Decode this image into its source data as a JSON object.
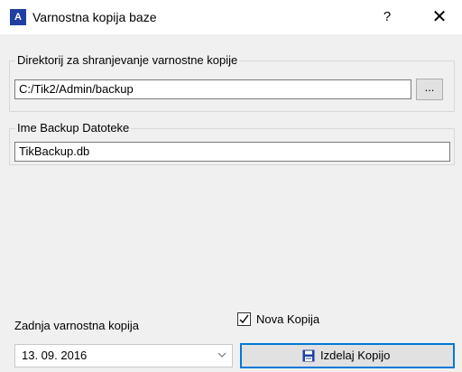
{
  "window": {
    "app_icon_letter": "A",
    "title": "Varnostna kopija baze",
    "help_label": "?",
    "close_label": "✕"
  },
  "directory_group": {
    "legend": "Direktorij za shranjevanje varnostne kopije",
    "path_value": "C:/Tik2/Admin/backup",
    "browse_label": "..."
  },
  "filename_group": {
    "legend": "Ime Backup Datoteke",
    "filename_value": "TikBackup.db"
  },
  "footer": {
    "last_backup_label": "Zadnja varnostna kopija",
    "last_backup_date": "13. 09. 2016",
    "new_copy_label": "Nova Kopija",
    "new_copy_checked": true,
    "create_button_label": "Izdelaj Kopijo"
  },
  "colors": {
    "app_icon_bg": "#1f3fa3",
    "focus_border": "#0078d7",
    "button_icon": "#1f3fa3"
  },
  "icons": {
    "app": "tik-logo-icon",
    "browse": "ellipsis",
    "dropdown": "chevron-down-icon",
    "save": "floppy-disk-icon"
  }
}
